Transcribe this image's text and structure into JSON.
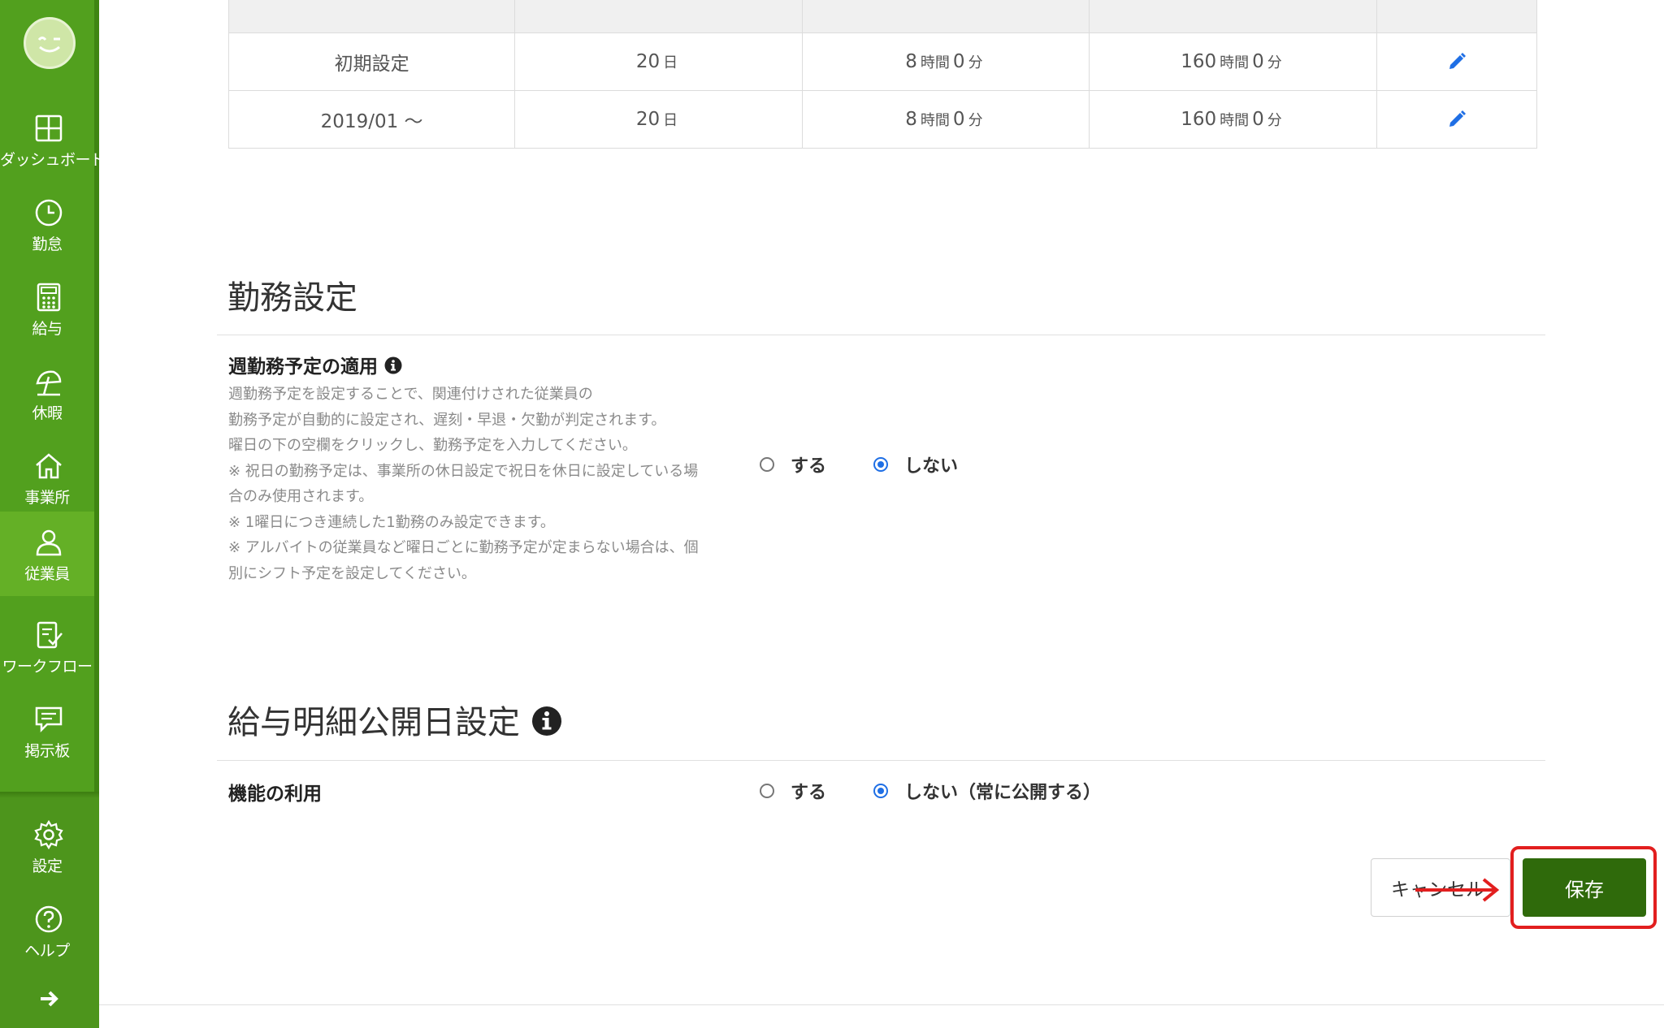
{
  "sidebar": {
    "items": [
      {
        "label": "ダッシュボード",
        "icon": "dashboard-icon"
      },
      {
        "label": "勤怠",
        "icon": "clock-icon"
      },
      {
        "label": "給与",
        "icon": "calculator-icon"
      },
      {
        "label": "休暇",
        "icon": "beach-umbrella-icon"
      },
      {
        "label": "事業所",
        "icon": "home-icon"
      },
      {
        "label": "従業員",
        "icon": "person-icon",
        "active": true
      },
      {
        "label": "ワークフロー",
        "icon": "checklist-icon"
      },
      {
        "label": "掲示板",
        "icon": "chat-bubble-icon"
      }
    ],
    "bottom_items": [
      {
        "label": "設定",
        "icon": "gear-icon"
      },
      {
        "label": "ヘルプ",
        "icon": "question-icon"
      }
    ],
    "brand_color": "#52a01e"
  },
  "shift_table": {
    "rows": [
      {
        "period": "初期設定",
        "days_num": "20",
        "days_unit": "日",
        "hours_num": "8",
        "hours_unit": "時間",
        "hours_min": "0",
        "hours_min_unit": "分",
        "monthly_num": "160",
        "monthly_unit": "時間",
        "monthly_min": "0",
        "monthly_min_unit": "分"
      },
      {
        "period": "2019/01 〜",
        "days_num": "20",
        "days_unit": "日",
        "hours_num": "8",
        "hours_unit": "時間",
        "hours_min": "0",
        "hours_min_unit": "分",
        "monthly_num": "160",
        "monthly_unit": "時間",
        "monthly_min": "0",
        "monthly_min_unit": "分"
      }
    ]
  },
  "work_settings": {
    "title": "勤務設定",
    "field_label": "週勤務予定の適用",
    "description": [
      "週勤務予定を設定することで、関連付けされた従業員の",
      "勤務予定が自動的に設定され、遅刻・早退・欠勤が判定されます。",
      "曜日の下の空欄をクリックし、勤務予定を入力してください。",
      "※ 祝日の勤務予定は、事業所の休日設定で祝日を休日に設定している場",
      "合のみ使用されます。",
      "※ 1曜日につき連続した1勤務のみ設定できます。",
      "※ アルバイトの従業員など曜日ごとに勤務予定が定まらない場合は、個",
      "別にシフト予定を設定してください。"
    ],
    "option_yes": "する",
    "option_no": "しない",
    "selected": "しない"
  },
  "payslip_settings": {
    "title": "給与明細公開日設定",
    "field_label": "機能の利用",
    "option_yes": "する",
    "option_no": "しない（常に公開する）",
    "selected": "しない（常に公開する）"
  },
  "actions": {
    "cancel_label": "キャンセル",
    "save_label": "保存"
  },
  "annotation_color": "#e21f1f",
  "selected_radio_color": "#1f6fe5"
}
